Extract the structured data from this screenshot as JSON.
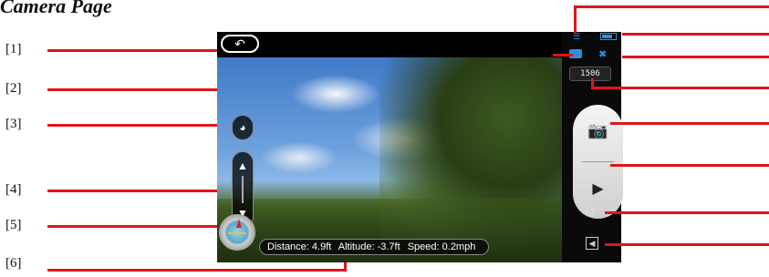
{
  "title": "Camera Page",
  "callouts": [
    {
      "label": "[1]"
    },
    {
      "label": "[2]"
    },
    {
      "label": "[3]"
    },
    {
      "label": "[4]"
    },
    {
      "label": "[5]"
    },
    {
      "label": "[6]"
    }
  ],
  "camera_ui": {
    "counter": "1506",
    "telemetry": {
      "distance": "Distance: 4.9ft",
      "altitude": "Altitude: -3.7ft",
      "speed": "Speed: 0.2mph"
    }
  },
  "icons": {
    "back": "back-arrow-icon",
    "gimbal": "gimbal-reset-icon",
    "up": "arrow-up-icon",
    "down": "arrow-down-icon",
    "compass": "compass-icon",
    "wifi": "wifi-icon",
    "battery": "battery-icon",
    "message": "message-icon",
    "drone": "drone-icon",
    "camera": "camera-icon",
    "video": "video-camera-icon",
    "settings": "gear-icon",
    "exit": "exit-icon"
  },
  "colors": {
    "callout_line": "#e0151b",
    "status_blue": "#2e8fe0"
  }
}
